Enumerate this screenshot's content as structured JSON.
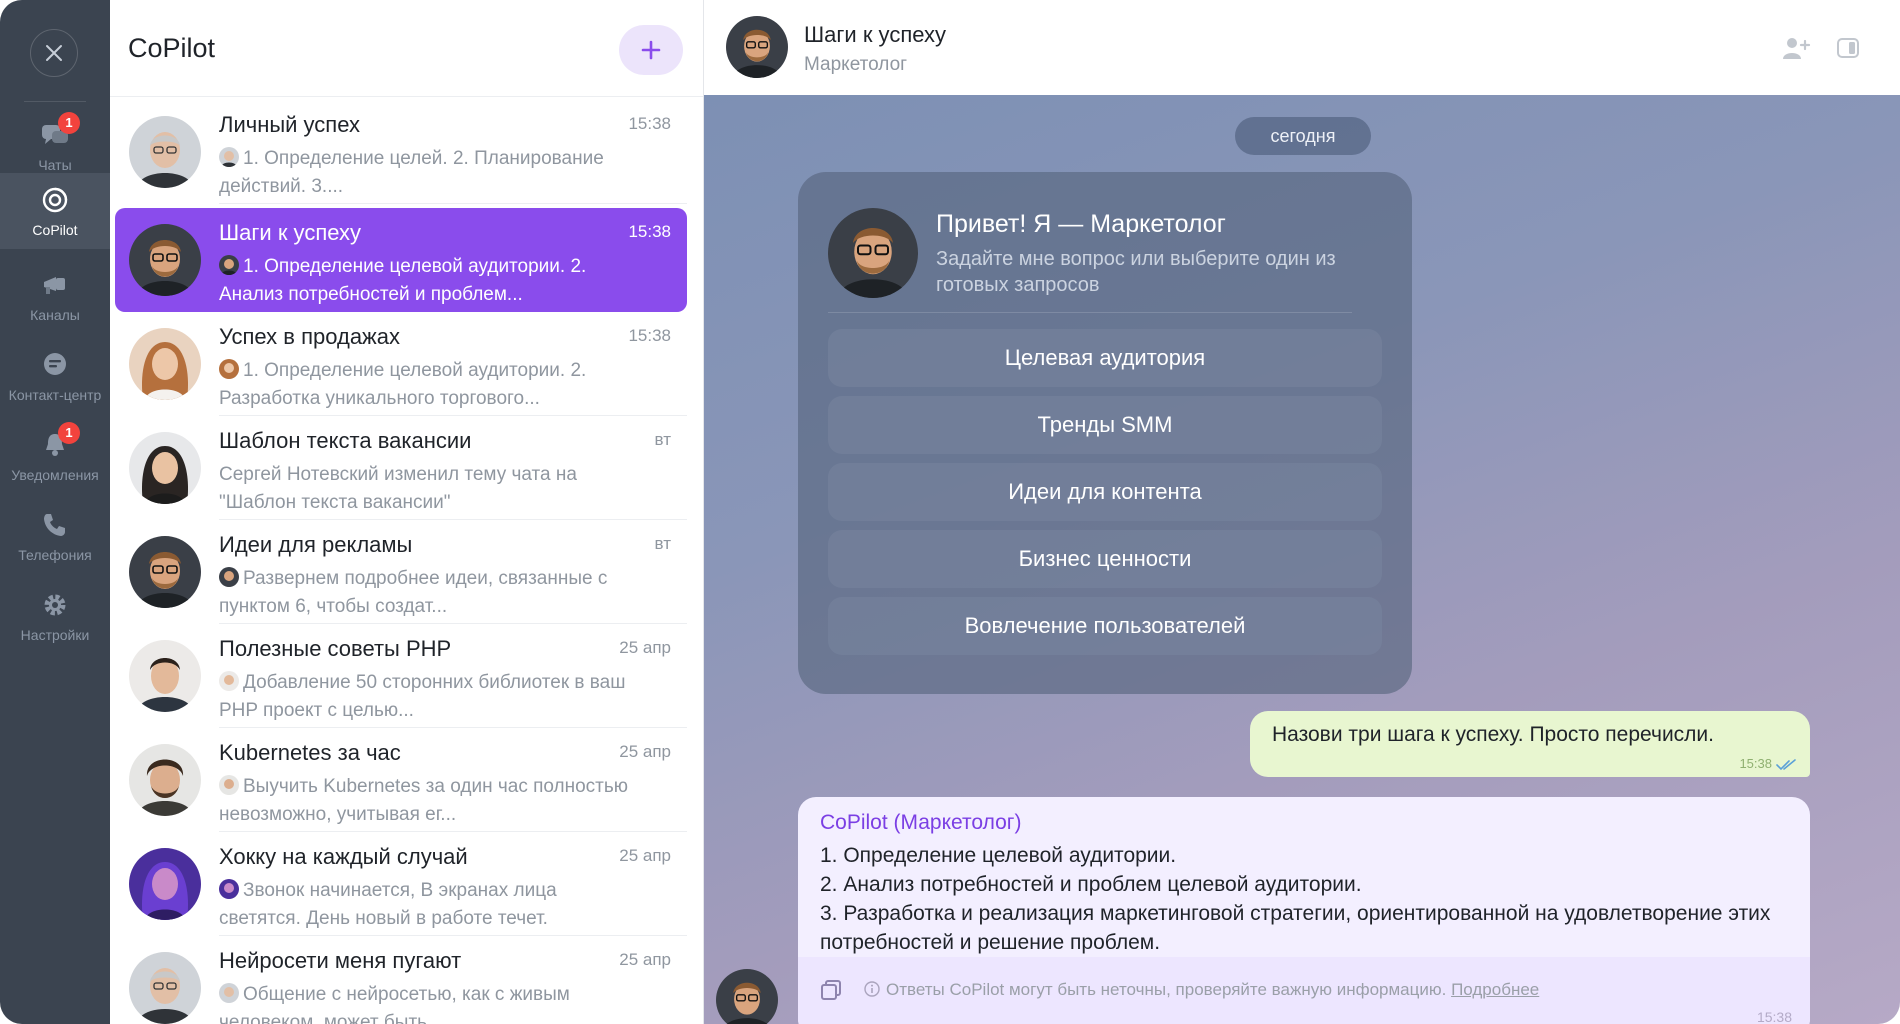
{
  "rail": {
    "items": [
      {
        "label": "Чаты",
        "icon": "chat-bubbles-icon",
        "badge": "1"
      },
      {
        "label": "CoPilot",
        "icon": "copilot-icon",
        "badge": ""
      },
      {
        "label": "Каналы",
        "icon": "megaphone-icon",
        "badge": ""
      },
      {
        "label": "Контакт-центр",
        "icon": "contact-center-icon",
        "badge": ""
      },
      {
        "label": "Уведомления",
        "icon": "bell-icon",
        "badge": "1"
      },
      {
        "label": "Телефония",
        "icon": "phone-icon",
        "badge": ""
      },
      {
        "label": "Настройки",
        "icon": "gear-icon",
        "badge": ""
      }
    ]
  },
  "list": {
    "title": "CoPilot",
    "chats": [
      {
        "name": "Личный успех",
        "time": "15:38",
        "preview": "1. Определение целей. 2. Планирование действий. 3...."
      },
      {
        "name": "Шаги к успеху",
        "time": "15:38",
        "preview": "1. Определение целевой аудитории. 2. Анализ потребностей и проблем..."
      },
      {
        "name": "Успех в продажах",
        "time": "15:38",
        "preview": "1. Определение целевой аудитории. 2. Разработка уникального торгового..."
      },
      {
        "name": "Шаблон текста вакансии",
        "time": "вт",
        "preview": "Сергей Нотевский изменил тему чата на \"Шаблон текста вакансии\""
      },
      {
        "name": "Идеи для рекламы",
        "time": "вт",
        "preview": "Развернем подробнее идеи, связанные с пунктом 6, чтобы создат..."
      },
      {
        "name": "Полезные советы PHP",
        "time": "25 апр",
        "preview": "Добавление 50 сторонних библиотек в ваш PHP проект с целью..."
      },
      {
        "name": "Kubernetes за час",
        "time": "25 апр",
        "preview": "Выучить Kubernetes за один час полностью невозможно, учитывая ег..."
      },
      {
        "name": "Хокку на каждый случай",
        "time": "25 апр",
        "preview": "Звонок начинается, В экранах лица светятся. День новый в работе течет."
      },
      {
        "name": "Нейросети меня пугают",
        "time": "25 апр",
        "preview": "Общение с нейросетью, как с живым человеком, может быть..."
      }
    ]
  },
  "conversation": {
    "title": "Шаги к успеху",
    "subtitle": "Маркетолог",
    "date": "сегодня",
    "welcome": {
      "title": "Привет! Я — Маркетолог",
      "subtitle": "Задайте мне вопрос или выберите один из готовых запросов",
      "buttons": [
        "Целевая аудитория",
        "Тренды SMM",
        "Идеи для контента",
        "Бизнес ценности",
        "Вовлечение пользователей"
      ]
    },
    "outgoing": {
      "text": "Назови три шага к успеху. Просто перечисли.",
      "time": "15:38"
    },
    "incoming": {
      "author": "CoPilot (Маркетолог)",
      "lines": [
        "1. Определение целевой аудитории.",
        "2. Анализ потребностей и проблем целевой аудитории.",
        "3. Разработка и реализация маркетинговой стратегии, ориентированной на удовлетворение этих потребностей и решение проблем."
      ],
      "disclaimer": "Ответы CoPilot могут быть неточны, проверяйте важную информацию.",
      "more_link": "Подробнее",
      "time": "15:38"
    }
  },
  "colors": {
    "accent": "#8a4cec",
    "rail_bg": "#3b4450",
    "badge": "#f2433d",
    "outgoing_bubble": "#e8f6d0",
    "incoming_bubble": "#f3efff"
  }
}
